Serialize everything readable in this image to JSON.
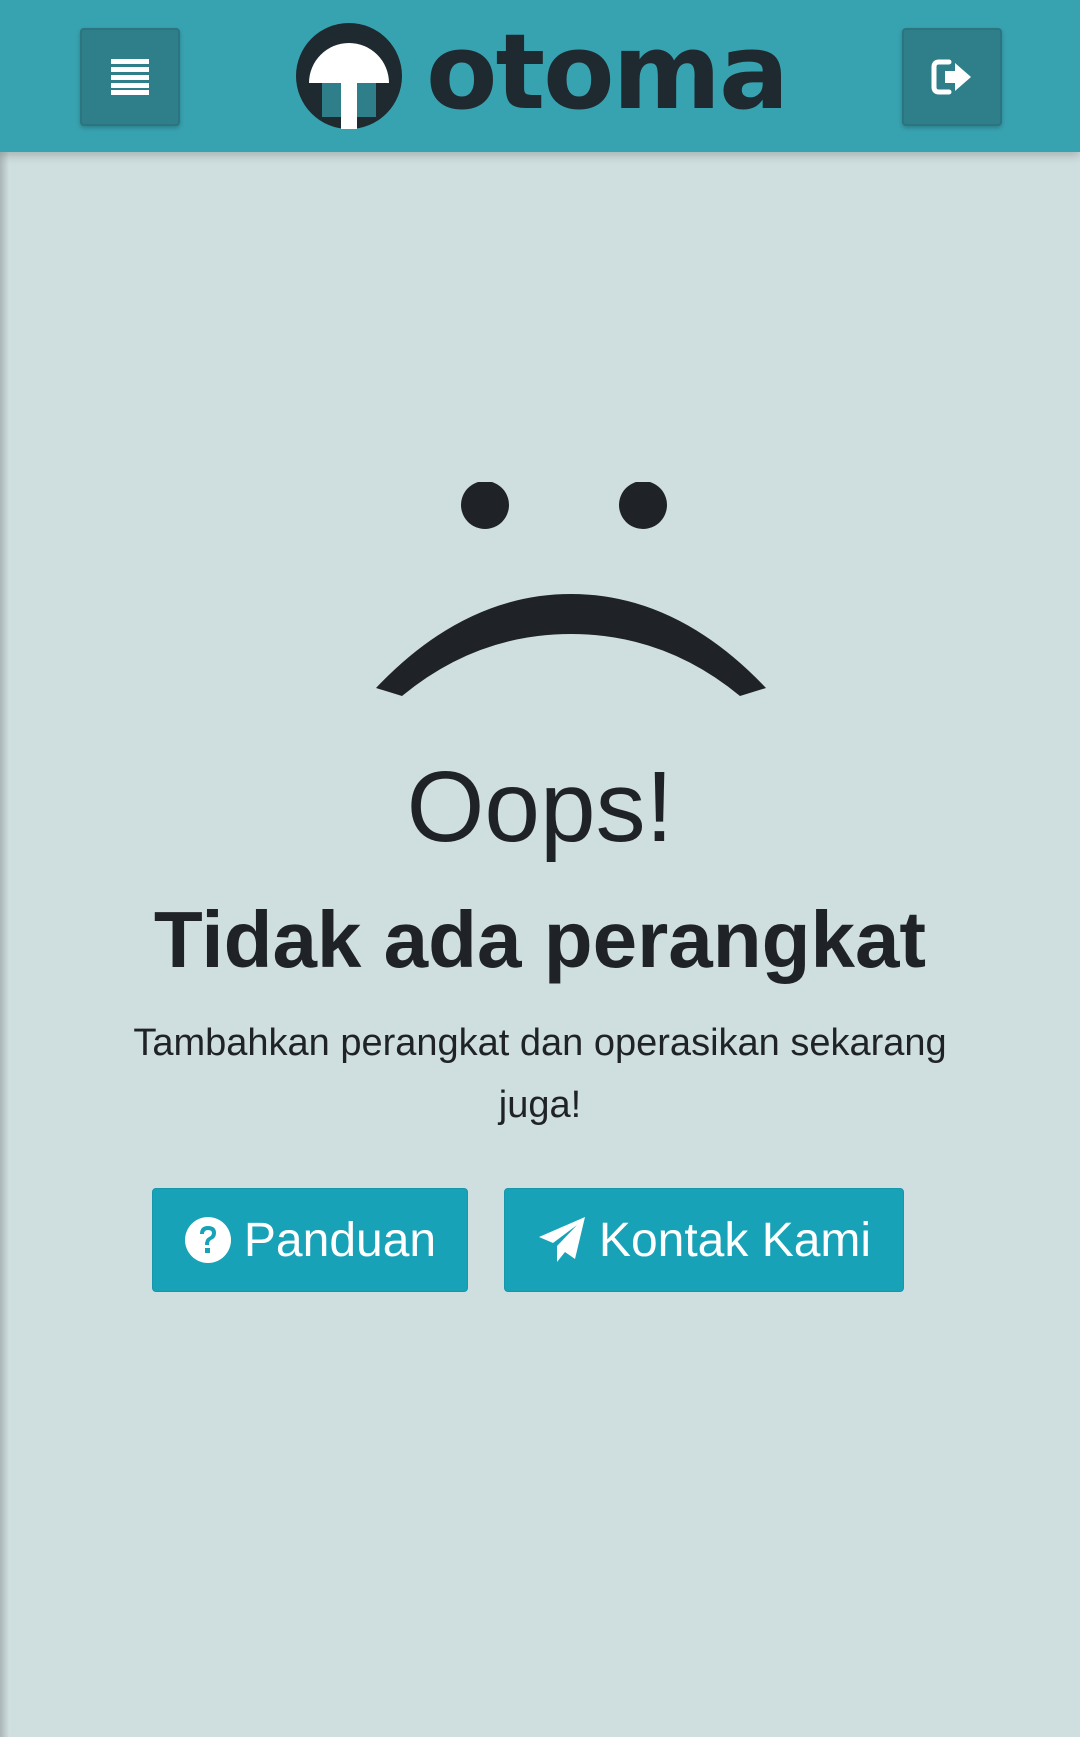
{
  "header": {
    "brand": "otoma",
    "menu_icon": "list-icon",
    "logout_icon": "sign-out-icon",
    "colors": {
      "bar": "#38a3b0",
      "button": "#2f7f8b"
    }
  },
  "empty_state": {
    "icon": "sad-face-icon",
    "title": "Oops!",
    "subtitle": "Tidak ada perangkat",
    "description": "Tambahkan perangkat dan operasikan sekarang juga!"
  },
  "actions": {
    "guide_label": "Panduan",
    "guide_icon": "question-circle-icon",
    "contact_label": "Kontak Kami",
    "contact_icon": "paper-plane-icon",
    "color": "#17a2b8"
  }
}
